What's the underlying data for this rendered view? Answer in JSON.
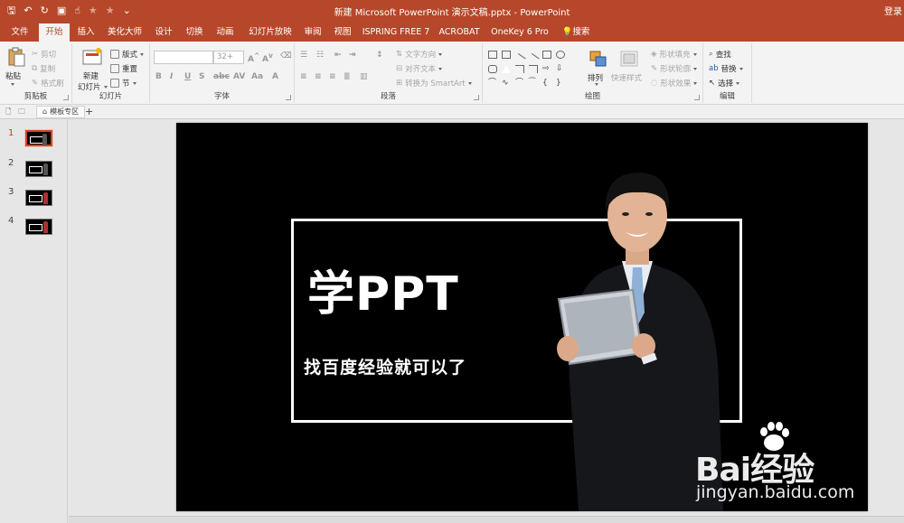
{
  "app": {
    "window_title": "新建 Microsoft PowerPoint 演示文稿.pptx  -  PowerPoint",
    "login_label": "登录",
    "accent_color": "#b7472a"
  },
  "qat": {
    "icons": [
      "save-icon",
      "undo-icon",
      "redo-icon",
      "present-from-start-icon",
      "touch-mode-icon",
      "star-icon",
      "star-icon",
      "customize-icon"
    ]
  },
  "tabs": [
    {
      "label": "文件"
    },
    {
      "label": "开始"
    },
    {
      "label": "插入"
    },
    {
      "label": "美化大师"
    },
    {
      "label": "设计"
    },
    {
      "label": "切换"
    },
    {
      "label": "动画"
    },
    {
      "label": "幻灯片放映"
    },
    {
      "label": "审阅"
    },
    {
      "label": "视图"
    },
    {
      "label": "ISPRING FREE 7"
    },
    {
      "label": "ACROBAT"
    },
    {
      "label": "OneKey 6 Pro"
    },
    {
      "label": "搜索"
    }
  ],
  "active_tab": "开始",
  "ribbon": {
    "clipboard": {
      "label": "剪贴板",
      "paste": "粘贴",
      "cut": "剪切",
      "copy": "复制",
      "format_painter": "格式刷"
    },
    "slides": {
      "label": "幻灯片",
      "new_slide_line1": "新建",
      "new_slide_line2": "幻灯片",
      "layout": "版式",
      "reset": "重置",
      "section": "节"
    },
    "font": {
      "label": "字体",
      "font_name": "",
      "font_size": "32+"
    },
    "paragraph": {
      "label": "段落",
      "text_direction": "文字方向",
      "align_text": "对齐文本",
      "convert_smartart": "转换为 SmartArt"
    },
    "drawing": {
      "label": "绘图",
      "arrange": "排列",
      "quick_styles": "快速样式",
      "shape_fill": "形状填充",
      "shape_outline": "形状轮廓",
      "shape_effects": "形状效果"
    },
    "editing": {
      "label": "编辑",
      "find": "查找",
      "replace": "替换",
      "select": "选择"
    }
  },
  "section_bar": {
    "tab_label": "模板专区",
    "add": "+"
  },
  "slides_panel": {
    "numbers": [
      "1",
      "2",
      "3",
      "4"
    ],
    "selected": 1
  },
  "slide": {
    "title": "学PPT",
    "subtitle": "找百度经验就可以了",
    "background": "#000000"
  },
  "watermark": {
    "brand": "Bai经验",
    "url": "jingyan.baidu.com"
  }
}
